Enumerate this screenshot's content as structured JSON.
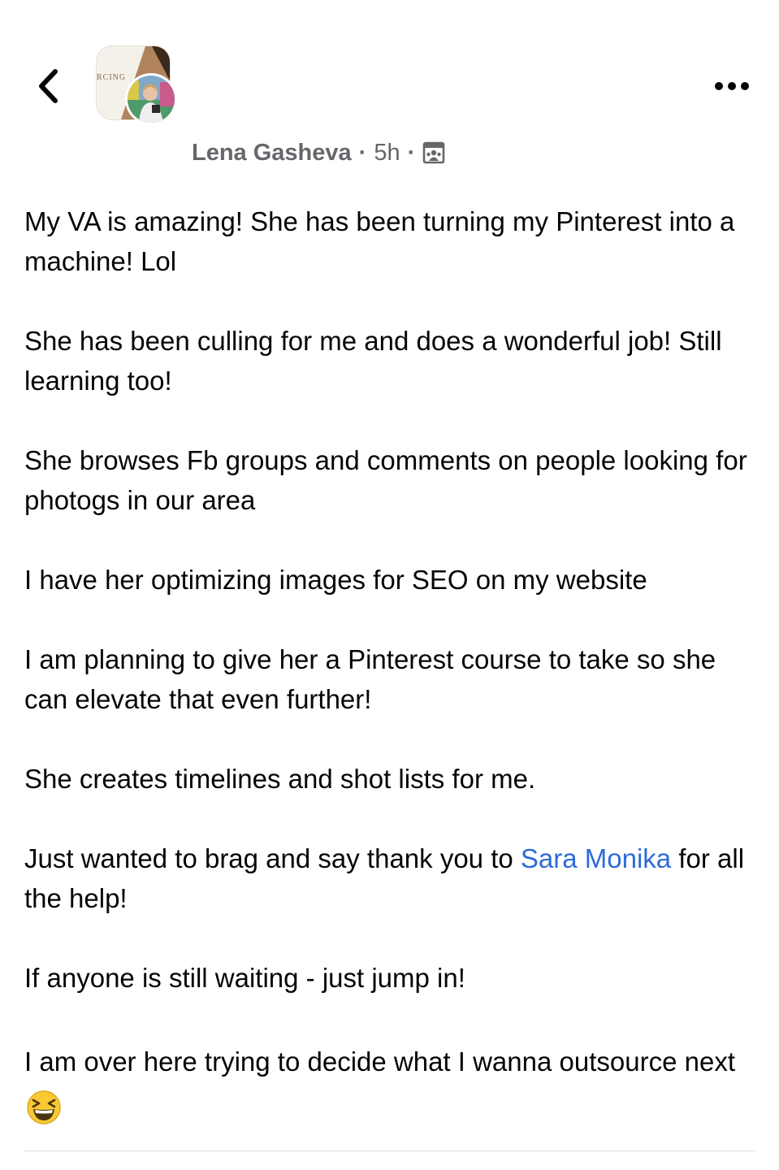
{
  "header": {
    "group_avatar_text": "RCING"
  },
  "post": {
    "author": "Lena Gasheva",
    "separator": "·",
    "time": "5h",
    "audience_icon": "group-members-icon",
    "paragraphs": [
      "My VA is amazing! She has been turning my Pinterest into a machine! Lol",
      "She has been culling for me and does a wonderful job! Still learning too!",
      "She browses Fb groups and comments on people looking for photogs in our area",
      "I have her optimizing images for SEO on my website",
      "I am planning to give her a Pinterest course to take so she can elevate that even further!",
      "She creates timelines and shot lists for me."
    ],
    "thanks": {
      "before": "Just wanted to brag and say thank you to ",
      "mention": "Sara Monika",
      "after": " for all the help!"
    },
    "jump_in": "If anyone is still waiting - just jump in!",
    "closing": "I am over here trying to decide what I wanna outsource next",
    "closing_emoji": "laughing-squint-emoji"
  },
  "colors": {
    "text": "#050505",
    "meta": "#65676b",
    "mention": "#2d6bd8",
    "divider": "#dcdde1"
  }
}
